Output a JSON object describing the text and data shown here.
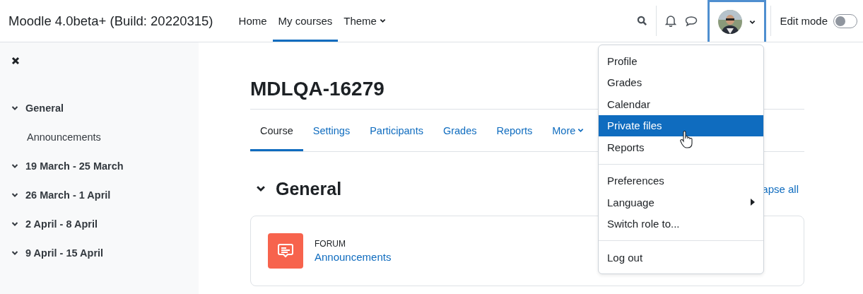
{
  "site_title": "Moodle 4.0beta+ (Build: 20220315)",
  "nav": [
    {
      "label": "Home",
      "selected": false,
      "dropdown": false
    },
    {
      "label": "My courses",
      "selected": true,
      "dropdown": false
    },
    {
      "label": "Theme",
      "selected": false,
      "dropdown": true
    }
  ],
  "edit_mode": {
    "label": "Edit mode",
    "on": false
  },
  "sidebar": {
    "items": [
      {
        "label": "General",
        "expanded": true,
        "children": [
          {
            "label": "Announcements"
          }
        ]
      },
      {
        "label": "19 March - 25 March",
        "expanded": true
      },
      {
        "label": "26 March - 1 April",
        "expanded": true
      },
      {
        "label": "2 April - 8 April",
        "expanded": true
      },
      {
        "label": "9 April - 15 April",
        "expanded": true
      }
    ]
  },
  "course": {
    "title": "MDLQA-16279",
    "tabs": [
      {
        "label": "Course",
        "selected": true,
        "dropdown": false
      },
      {
        "label": "Settings",
        "selected": false,
        "dropdown": false
      },
      {
        "label": "Participants",
        "selected": false,
        "dropdown": false
      },
      {
        "label": "Grades",
        "selected": false,
        "dropdown": false
      },
      {
        "label": "Reports",
        "selected": false,
        "dropdown": false
      },
      {
        "label": "More",
        "selected": false,
        "dropdown": true
      }
    ],
    "section": {
      "title": "General",
      "expanded": true,
      "collapse_link": "apse all",
      "activities": [
        {
          "type": "FORUM",
          "name": "Announcements"
        }
      ]
    }
  },
  "user_menu": {
    "open": true,
    "groups": [
      [
        {
          "label": "Profile",
          "selected": false,
          "submenu": false
        },
        {
          "label": "Grades",
          "selected": false,
          "submenu": false
        },
        {
          "label": "Calendar",
          "selected": false,
          "submenu": false
        },
        {
          "label": "Private files",
          "selected": true,
          "submenu": false
        },
        {
          "label": "Reports",
          "selected": false,
          "submenu": false
        }
      ],
      [
        {
          "label": "Preferences",
          "selected": false,
          "submenu": false
        },
        {
          "label": "Language",
          "selected": false,
          "submenu": true
        },
        {
          "label": "Switch role to...",
          "selected": false,
          "submenu": false
        }
      ],
      [
        {
          "label": "Log out",
          "selected": false,
          "submenu": false
        }
      ]
    ]
  }
}
